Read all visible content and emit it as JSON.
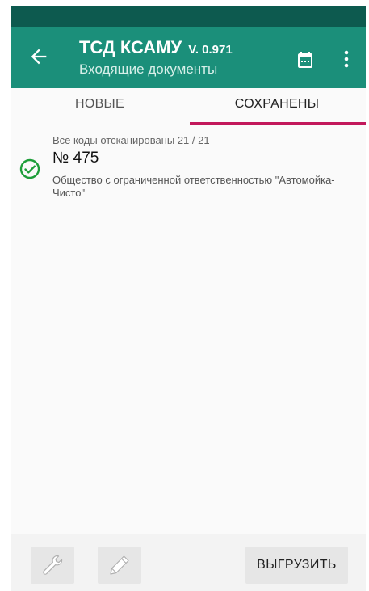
{
  "appbar": {
    "title": "ТСД КСАМУ",
    "version": "V. 0.971",
    "subtitle": "Входящие документы",
    "back_icon": "arrow-left-icon",
    "calendar_icon": "calendar-icon",
    "more_icon": "more-vertical-icon"
  },
  "tabs": [
    {
      "label": "НОВЫЕ",
      "selected": false
    },
    {
      "label": "СОХРАНЕНЫ",
      "selected": true
    }
  ],
  "documents": [
    {
      "status": "Все коды отсканированы 21 / 21",
      "number": "№ 475",
      "organization": "Общество с ограниченной ответственностью \"Автомойка-Чисто\"",
      "status_icon": "check-circle-icon"
    }
  ],
  "bottombar": {
    "wrench_icon": "wrench-icon",
    "pencil_icon": "pencil-icon",
    "upload_label": "ВЫГРУЗИТЬ"
  },
  "colors": {
    "statusbar": "#0d5a4f",
    "appbar": "#1b8f7a",
    "tab_indicator": "#c2185b",
    "check": "#1e9e3a"
  }
}
